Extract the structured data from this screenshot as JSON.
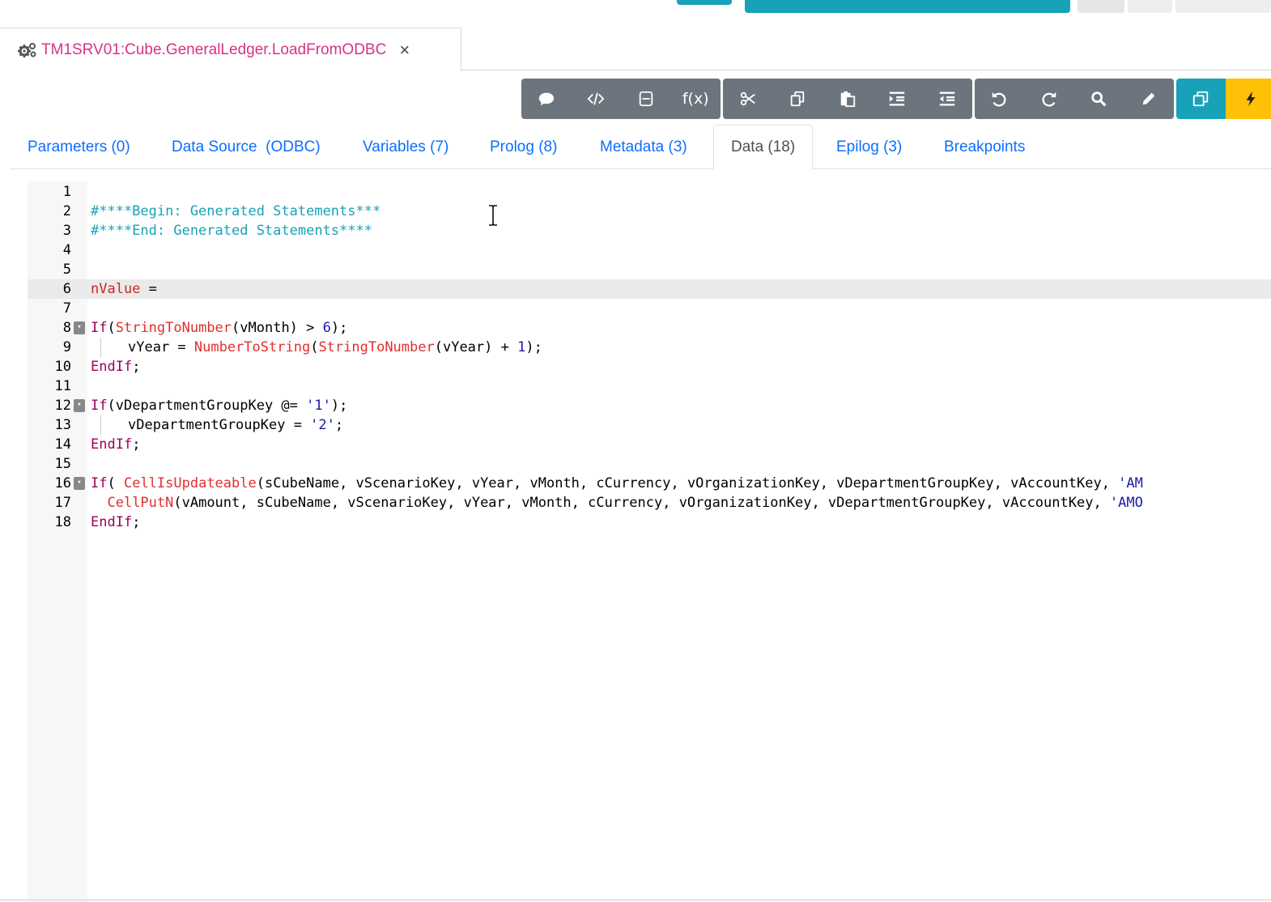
{
  "document_tab": {
    "title": "TM1SRV01:Cube.GeneralLedger.LoadFromODBC",
    "close": "×"
  },
  "toolbar": {
    "groups": [
      [
        "comment-icon",
        "code-icon",
        "collapse-icon",
        "function-icon"
      ],
      [
        "cut-icon",
        "copy-icon",
        "paste-icon",
        "indent-icon",
        "outdent-icon"
      ],
      [
        "undo-icon",
        "redo-icon",
        "search-icon",
        "edit-icon"
      ],
      [
        "clone-icon",
        "execute-icon"
      ]
    ],
    "fx_label": "f(x)"
  },
  "tabs": [
    {
      "label": "Parameters (0)",
      "active": false
    },
    {
      "label": "Data Source  (ODBC)",
      "active": false
    },
    {
      "label": "Variables (7)",
      "active": false
    },
    {
      "label": "Prolog (8)",
      "active": false
    },
    {
      "label": "Metadata (3)",
      "active": false
    },
    {
      "label": "Data (18)",
      "active": true
    },
    {
      "label": "Epilog (3)",
      "active": false
    },
    {
      "label": "Breakpoints",
      "active": false
    }
  ],
  "editor": {
    "active_line": 6,
    "lines": [
      {
        "n": "1"
      },
      {
        "n": "2",
        "t": "#****Begin: Generated Statements***"
      },
      {
        "n": "3",
        "t": "#****End: Generated Statements****"
      },
      {
        "n": "4"
      },
      {
        "n": "5"
      },
      {
        "n": "6",
        "t": "nValue ="
      },
      {
        "n": "7"
      },
      {
        "n": "8",
        "t": "If(StringToNumber(vMonth) > 6);"
      },
      {
        "n": "9",
        "t": "    vYear = NumberToString(StringToNumber(vYear) + 1);"
      },
      {
        "n": "10",
        "t": "EndIf;"
      },
      {
        "n": "11"
      },
      {
        "n": "12",
        "t": "If(vDepartmentGroupKey @= '1');"
      },
      {
        "n": "13",
        "t": "    vDepartmentGroupKey = '2';"
      },
      {
        "n": "14",
        "t": "EndIf;"
      },
      {
        "n": "15"
      },
      {
        "n": "16",
        "t": "If( CellIsUpdateable(sCubeName, vScenarioKey, vYear, vMonth, cCurrency, vOrganizationKey, vDepartmentGroupKey, vAccountKey, 'AM"
      },
      {
        "n": "17",
        "t": "  CellPutN(vAmount, sCubeName, vScenarioKey, vYear, vMonth, cCurrency, vOrganizationKey, vDepartmentGroupKey, vAccountKey, 'AMO"
      },
      {
        "n": "18",
        "t": "EndIf;"
      }
    ]
  },
  "colors": {
    "accent": "#17a2b8",
    "toolbar": "#6c757d",
    "execute": "#ffc107",
    "title": "#d63384",
    "link": "#0d6efd"
  }
}
